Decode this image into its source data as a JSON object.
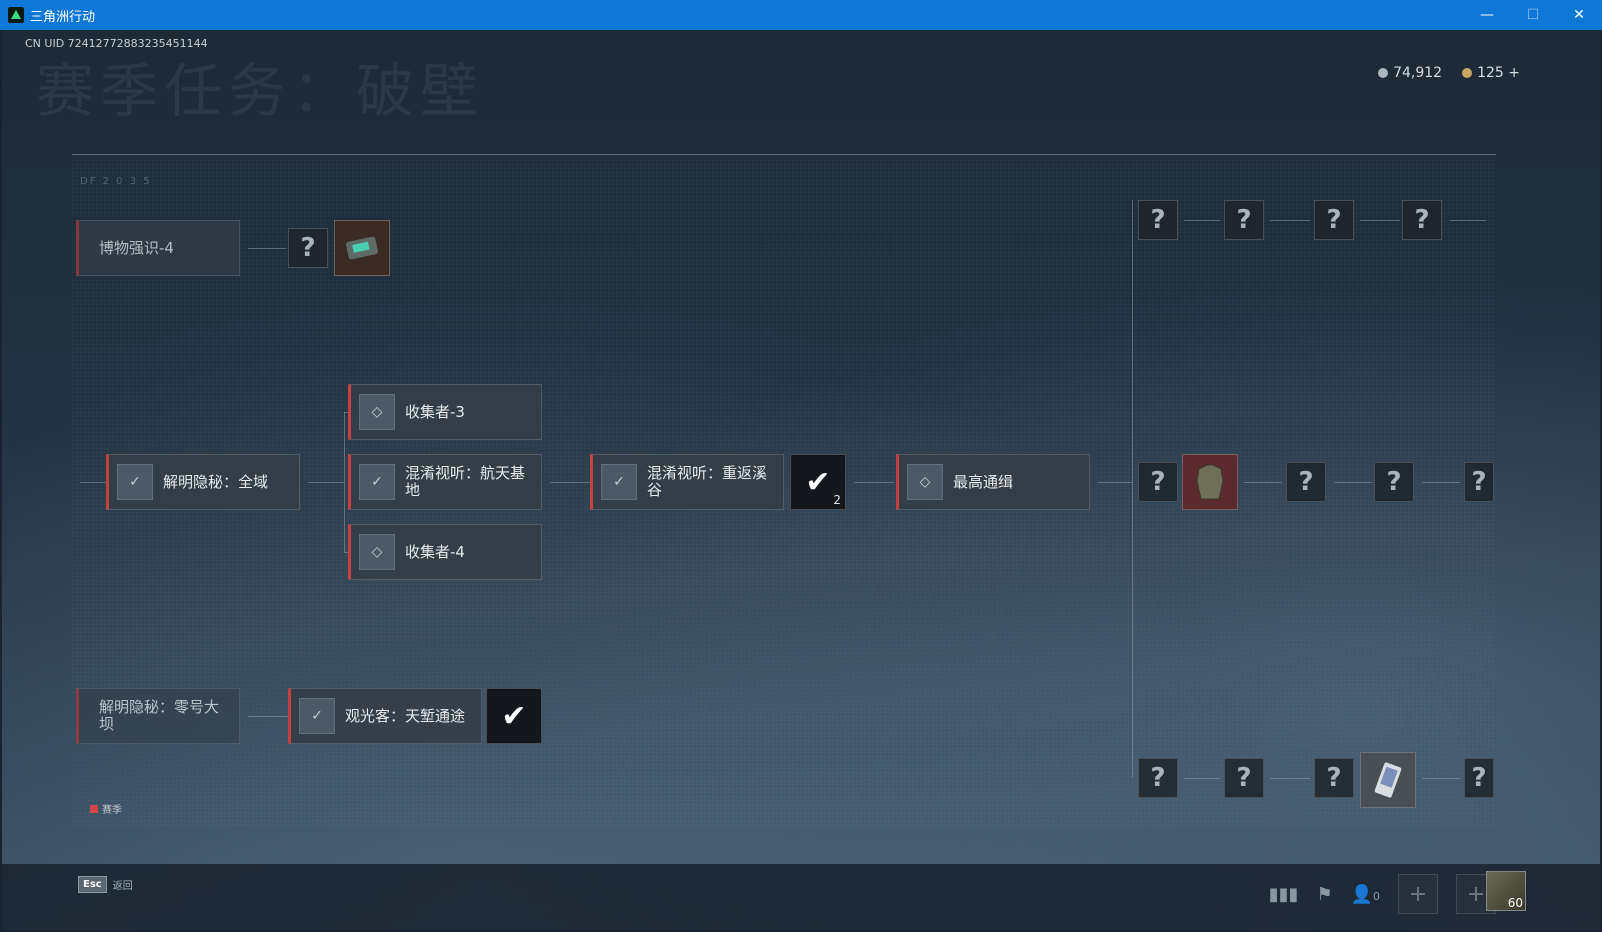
{
  "window": {
    "title": "三角洲行动",
    "minimize": "—",
    "maximize": "☐",
    "close": "✕"
  },
  "header": {
    "uid": "CN UID 724127728832354511​44",
    "season_title": "赛季任务：破壁",
    "df_code": "DF 2 0 3 5",
    "currency": [
      {
        "icon": "silver-coin-icon",
        "value": "74,912"
      },
      {
        "icon": "gold-coin-icon",
        "value": "125 +"
      }
    ]
  },
  "tasks": {
    "museum": "博物强识-4",
    "reveal_all": "解明隐秘：全域",
    "collector3": "收集者-3",
    "confuse_space": "混淆视听：航天基地",
    "collector4": "收集者-4",
    "confuse_valley": "混淆视听：重返溪谷",
    "most_wanted": "最高通缉",
    "reveal_dam": "解明隐秘：零号大坝",
    "sightseer": "观光客：天堑通途"
  },
  "unknown": "?",
  "check_count": "2",
  "legend": {
    "label": "赛季"
  },
  "footer": {
    "esc_key": "Esc",
    "back": "返回",
    "friends_count": "0",
    "level": "60"
  }
}
